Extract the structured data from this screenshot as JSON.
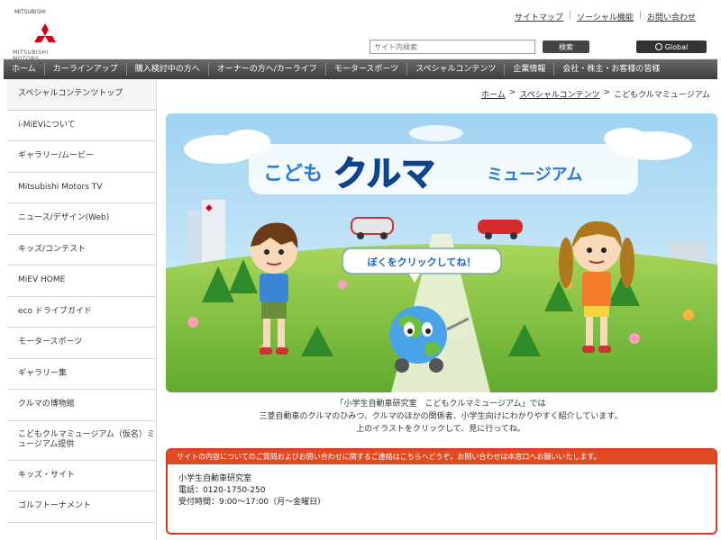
{
  "header": {
    "logo_top": "MITSUBISHI",
    "logo_bottom": "MITSUBISHI MOTORS",
    "top_links": [
      "サイトマップ",
      "ソーシャル機能",
      "お問い合わせ"
    ],
    "search_placeholder": "サイト内検索",
    "search_button": "検索",
    "global_button": "Global"
  },
  "nav": {
    "items": [
      "ホーム",
      "カーラインアップ",
      "購入検討中の方へ",
      "オーナーの方へ/カーライフ",
      "モータースポーツ",
      "スペシャルコンテンツ",
      "企業情報",
      "会社・株主・お客様の皆様"
    ]
  },
  "sidebar": {
    "items": [
      "スペシャルコンテンツトップ",
      "i-MiEVについて",
      "ギャラリー/ムービー",
      "Mitsubishi Motors TV",
      "ニュース/デザイン(Web)",
      "キッズ/コンテスト",
      "MiEV HOME",
      "eco ドライブガイド",
      "モータースポーツ",
      "ギャラリー集",
      "クルマの博物館",
      "こどもクルマミュージアム（仮名）ミュージアム提供",
      "キッズ・サイト",
      "ゴルフトーナメント"
    ]
  },
  "breadcrumb": {
    "home": "ホーム",
    "sep": ">",
    "section": "スペシャルコンテンツ",
    "current": "こどもクルマミュージアム"
  },
  "banner": {
    "title_left": "こども",
    "title_main": "クルマ",
    "title_right": "ミュージアム",
    "speech": "ぼくをクリックしてね！"
  },
  "description": {
    "line1": "「小学生自動車研究室　こどもクルマミュージアム」では",
    "line2": "三菱自動車のクルマのひみつ、クルマのほかの関係者、小学生向けにわかりやすく紹介しています。",
    "line3": "上のイラストをクリックして、見に行ってね。"
  },
  "info": {
    "head": "サイトの内容についてのご質問およびお問い合わせに関するご連絡はこちらへどうぞ。お問い合わせは本窓口へお願いいたします。",
    "name": "小学生自動車研究室",
    "phone": "電話：0120-1750-250",
    "hours": "受付時間：9:00〜17:00（月〜金曜日）"
  },
  "colors": {
    "nav_dark": "#3c3c3c",
    "accent_red": "#e24a24",
    "title_blue": "#1a66c8",
    "grass": "#7cc24a",
    "sky": "#bfe3f7"
  }
}
